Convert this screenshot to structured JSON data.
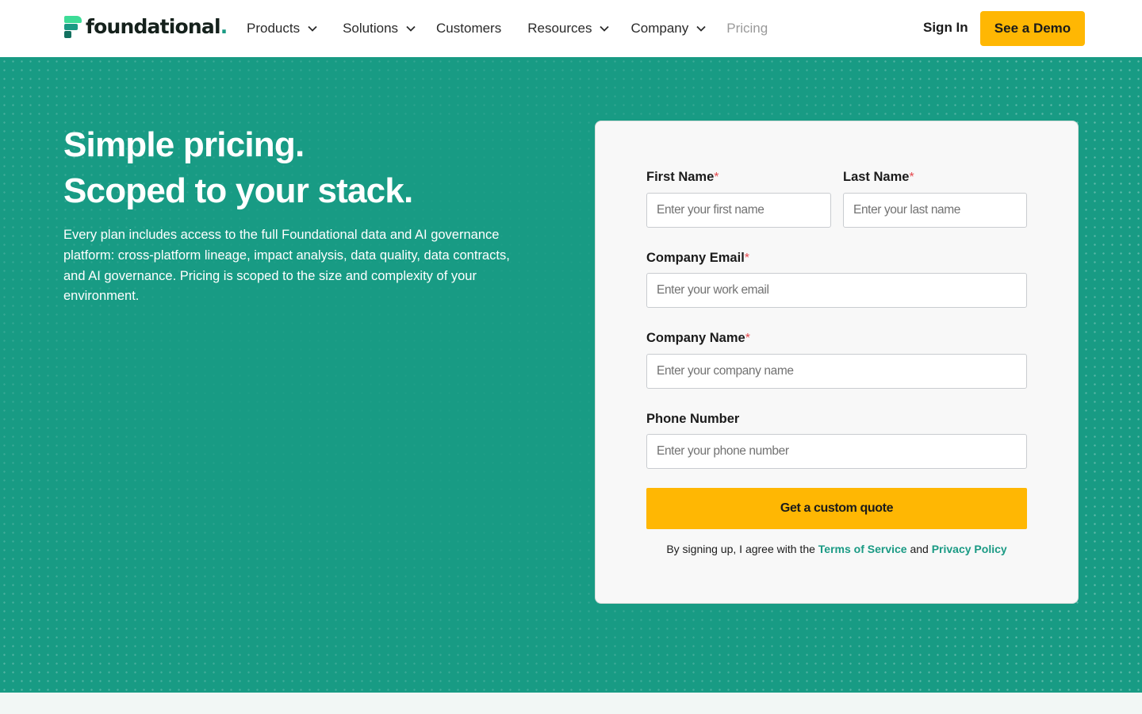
{
  "brand": {
    "name": "foundational",
    "dot": ".",
    "colors": {
      "teal": "#189b84",
      "accent": "#ffb703",
      "required": "#e5484d"
    }
  },
  "nav": {
    "items": [
      {
        "label": "Products",
        "dropdown": true
      },
      {
        "label": "Solutions",
        "dropdown": true
      },
      {
        "label": "Customers",
        "dropdown": false
      },
      {
        "label": "Resources",
        "dropdown": true
      },
      {
        "label": "Company",
        "dropdown": true
      },
      {
        "label": "Pricing",
        "dropdown": false
      }
    ],
    "sign_in": "Sign In",
    "demo": "See a Demo"
  },
  "hero": {
    "title_line1": "Simple pricing.",
    "title_line2": "Scoped to your stack.",
    "description": "Every plan includes access to the full Foundational data and AI governance platform: cross-platform lineage, impact analysis, data quality, data contracts, and AI governance. Pricing is scoped to the size and complexity of your environment."
  },
  "form": {
    "required_mark": "*",
    "first_name": {
      "label": "First Name",
      "placeholder": "Enter your first name"
    },
    "last_name": {
      "label": "Last Name",
      "placeholder": "Enter your last name"
    },
    "email": {
      "label": "Company Email",
      "placeholder": "Enter your work email"
    },
    "company": {
      "label": "Company Name",
      "placeholder": "Enter your company name"
    },
    "phone": {
      "label": "Phone Number",
      "placeholder": "Enter your phone number"
    },
    "submit": "Get a custom quote",
    "legal": {
      "prefix": "By signing up, I agree with the ",
      "terms": "Terms of Service",
      "and": " and ",
      "privacy": "Privacy Policy"
    }
  }
}
